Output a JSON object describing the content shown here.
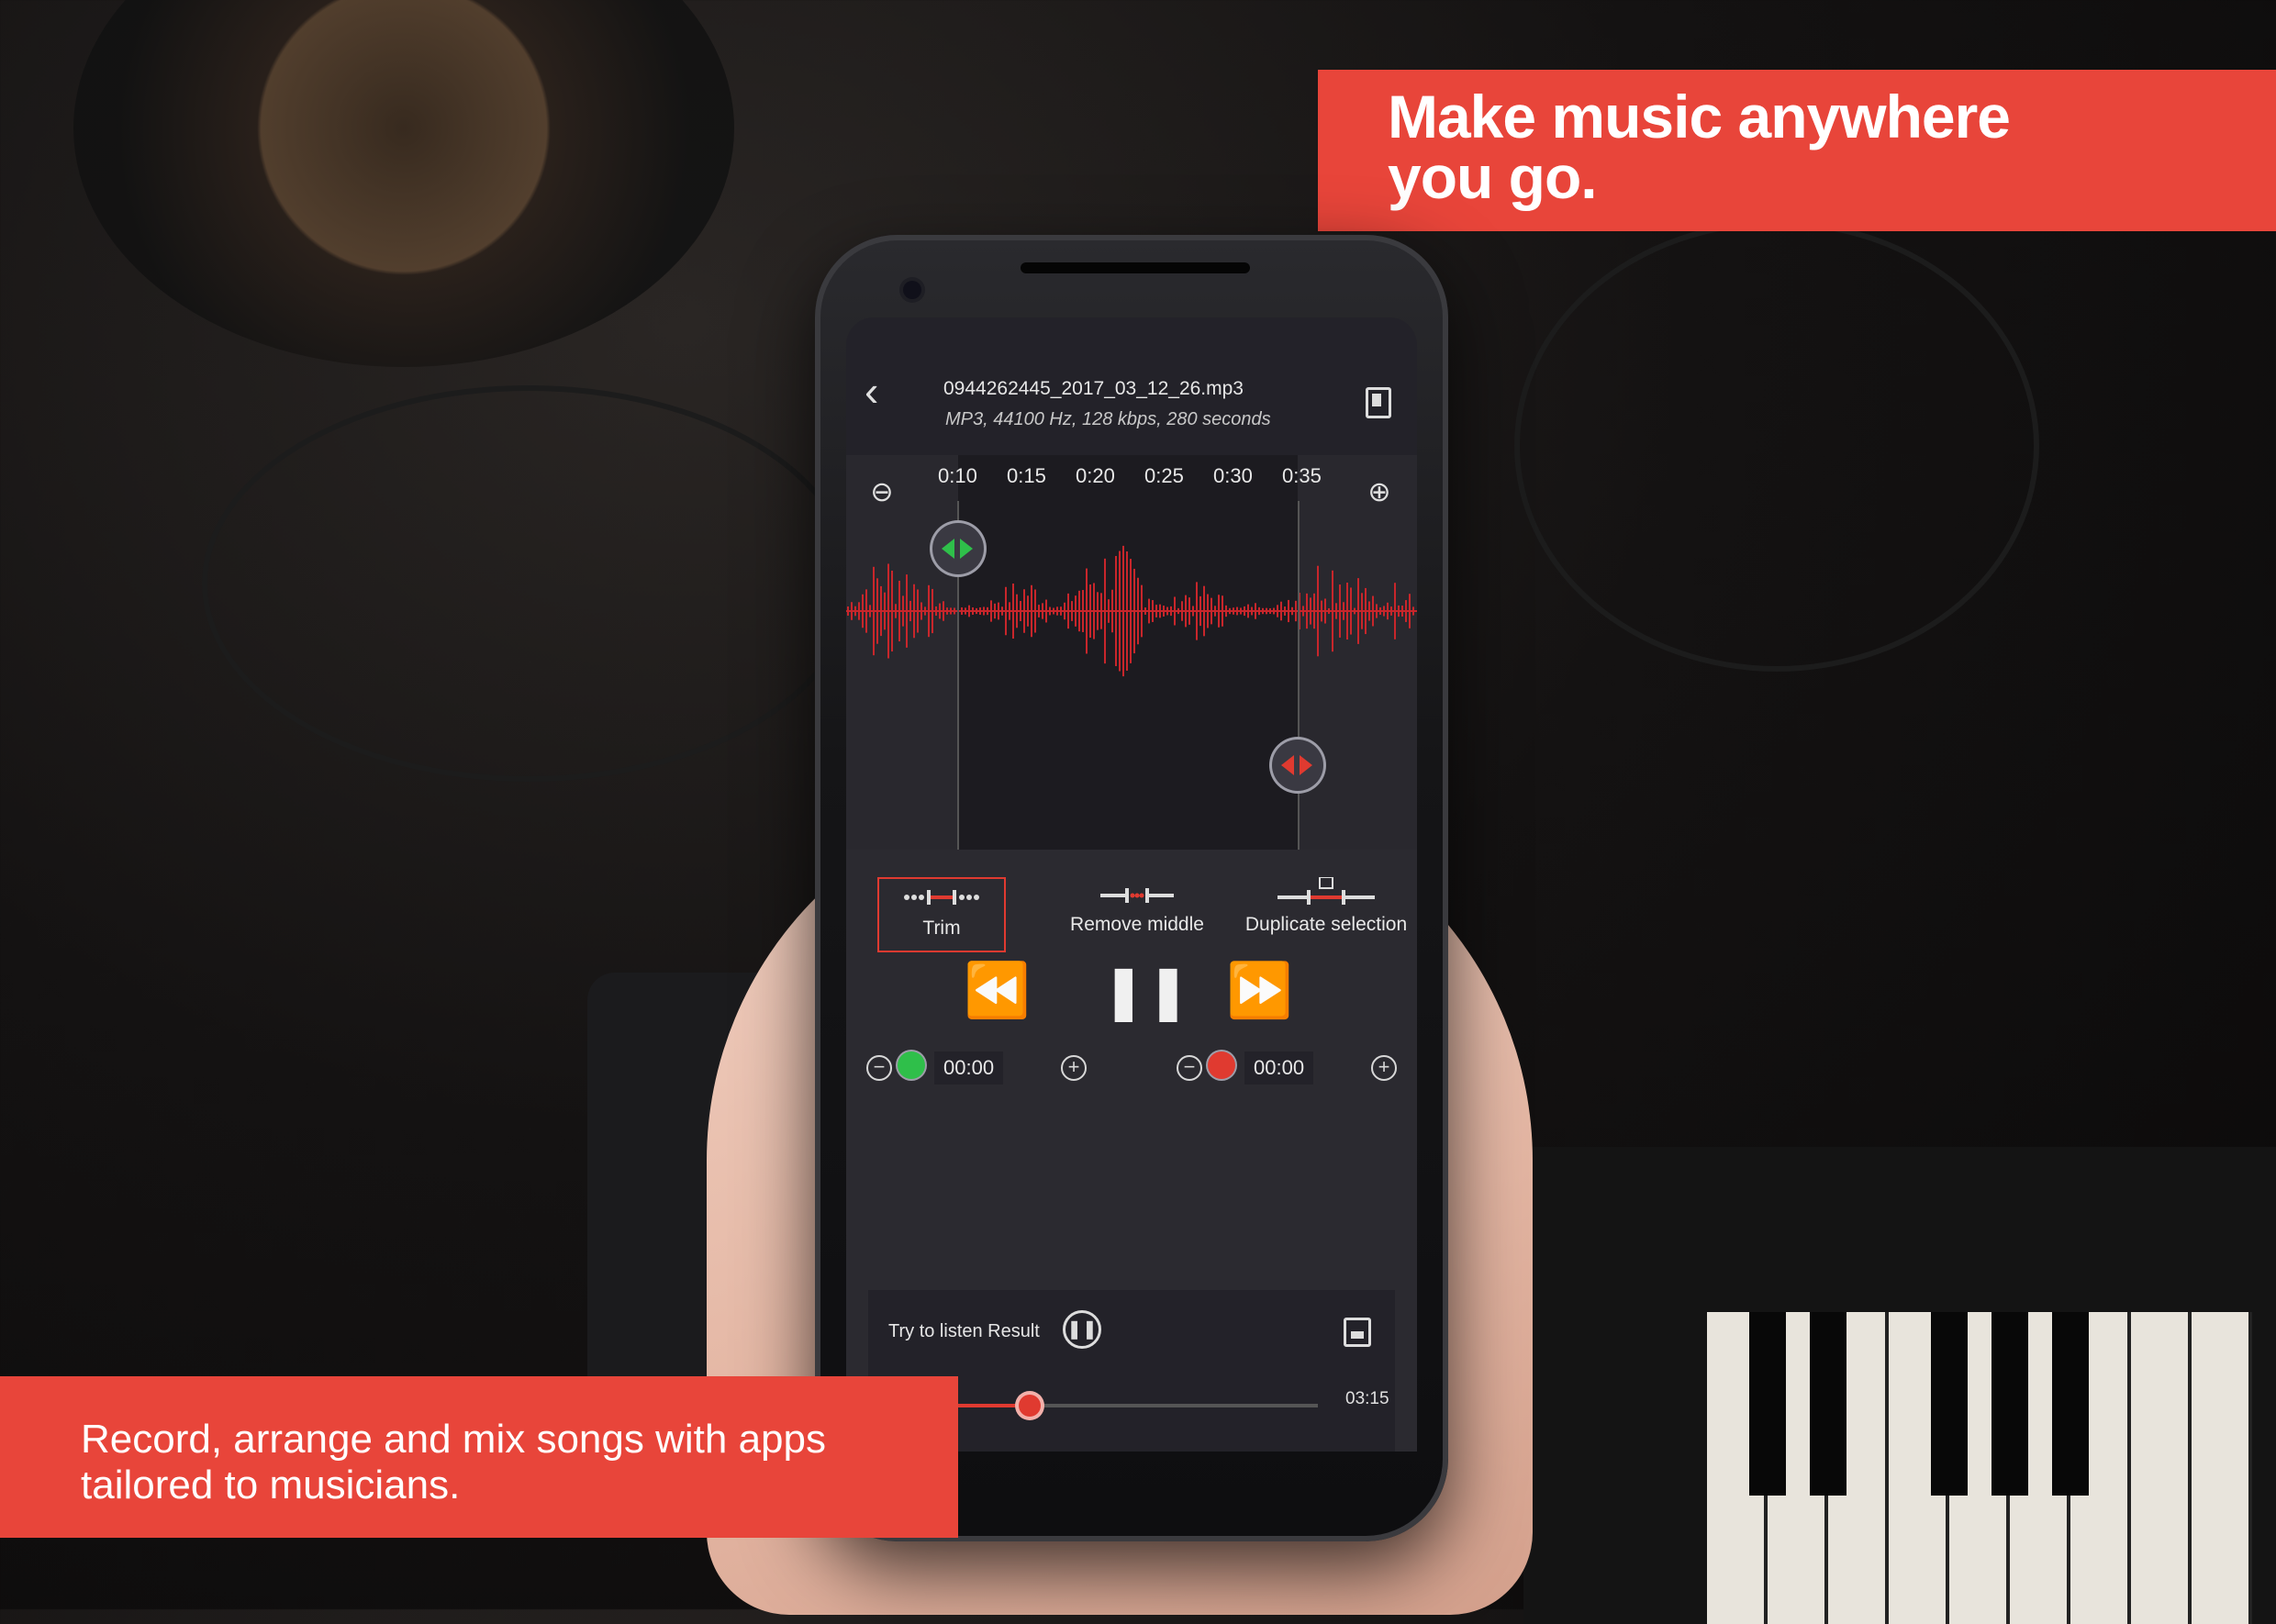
{
  "banner_top": {
    "text": "Make music anywhere\nyou go."
  },
  "banner_bottom": {
    "text": "Record, arrange and mix songs with apps\ntailored to musicians."
  },
  "header": {
    "file_name": "0944262445_2017_03_12_26.mp3",
    "file_meta": "MP3, 44100 Hz, 128 kbps, 280 seconds"
  },
  "timeline": {
    "ticks": [
      "0:10",
      "0:15",
      "0:20",
      "0:25",
      "0:30",
      "0:35"
    ]
  },
  "tools": {
    "trim": "Trim",
    "remove_middle": "Remove middle",
    "duplicate_selection": "Duplicate selection"
  },
  "transport": {
    "rewind": "⏪",
    "pause": "❚❚",
    "forward": "⏩"
  },
  "start_counter": {
    "value": "00:00"
  },
  "end_counter": {
    "value": "00:00"
  },
  "result": {
    "label": "Try to listen Result",
    "duration": "03:15",
    "progress": 0.36
  },
  "colors": {
    "accent": "#e8453a",
    "start_handle": "#2fbf4a",
    "end_handle": "#e03a30"
  }
}
